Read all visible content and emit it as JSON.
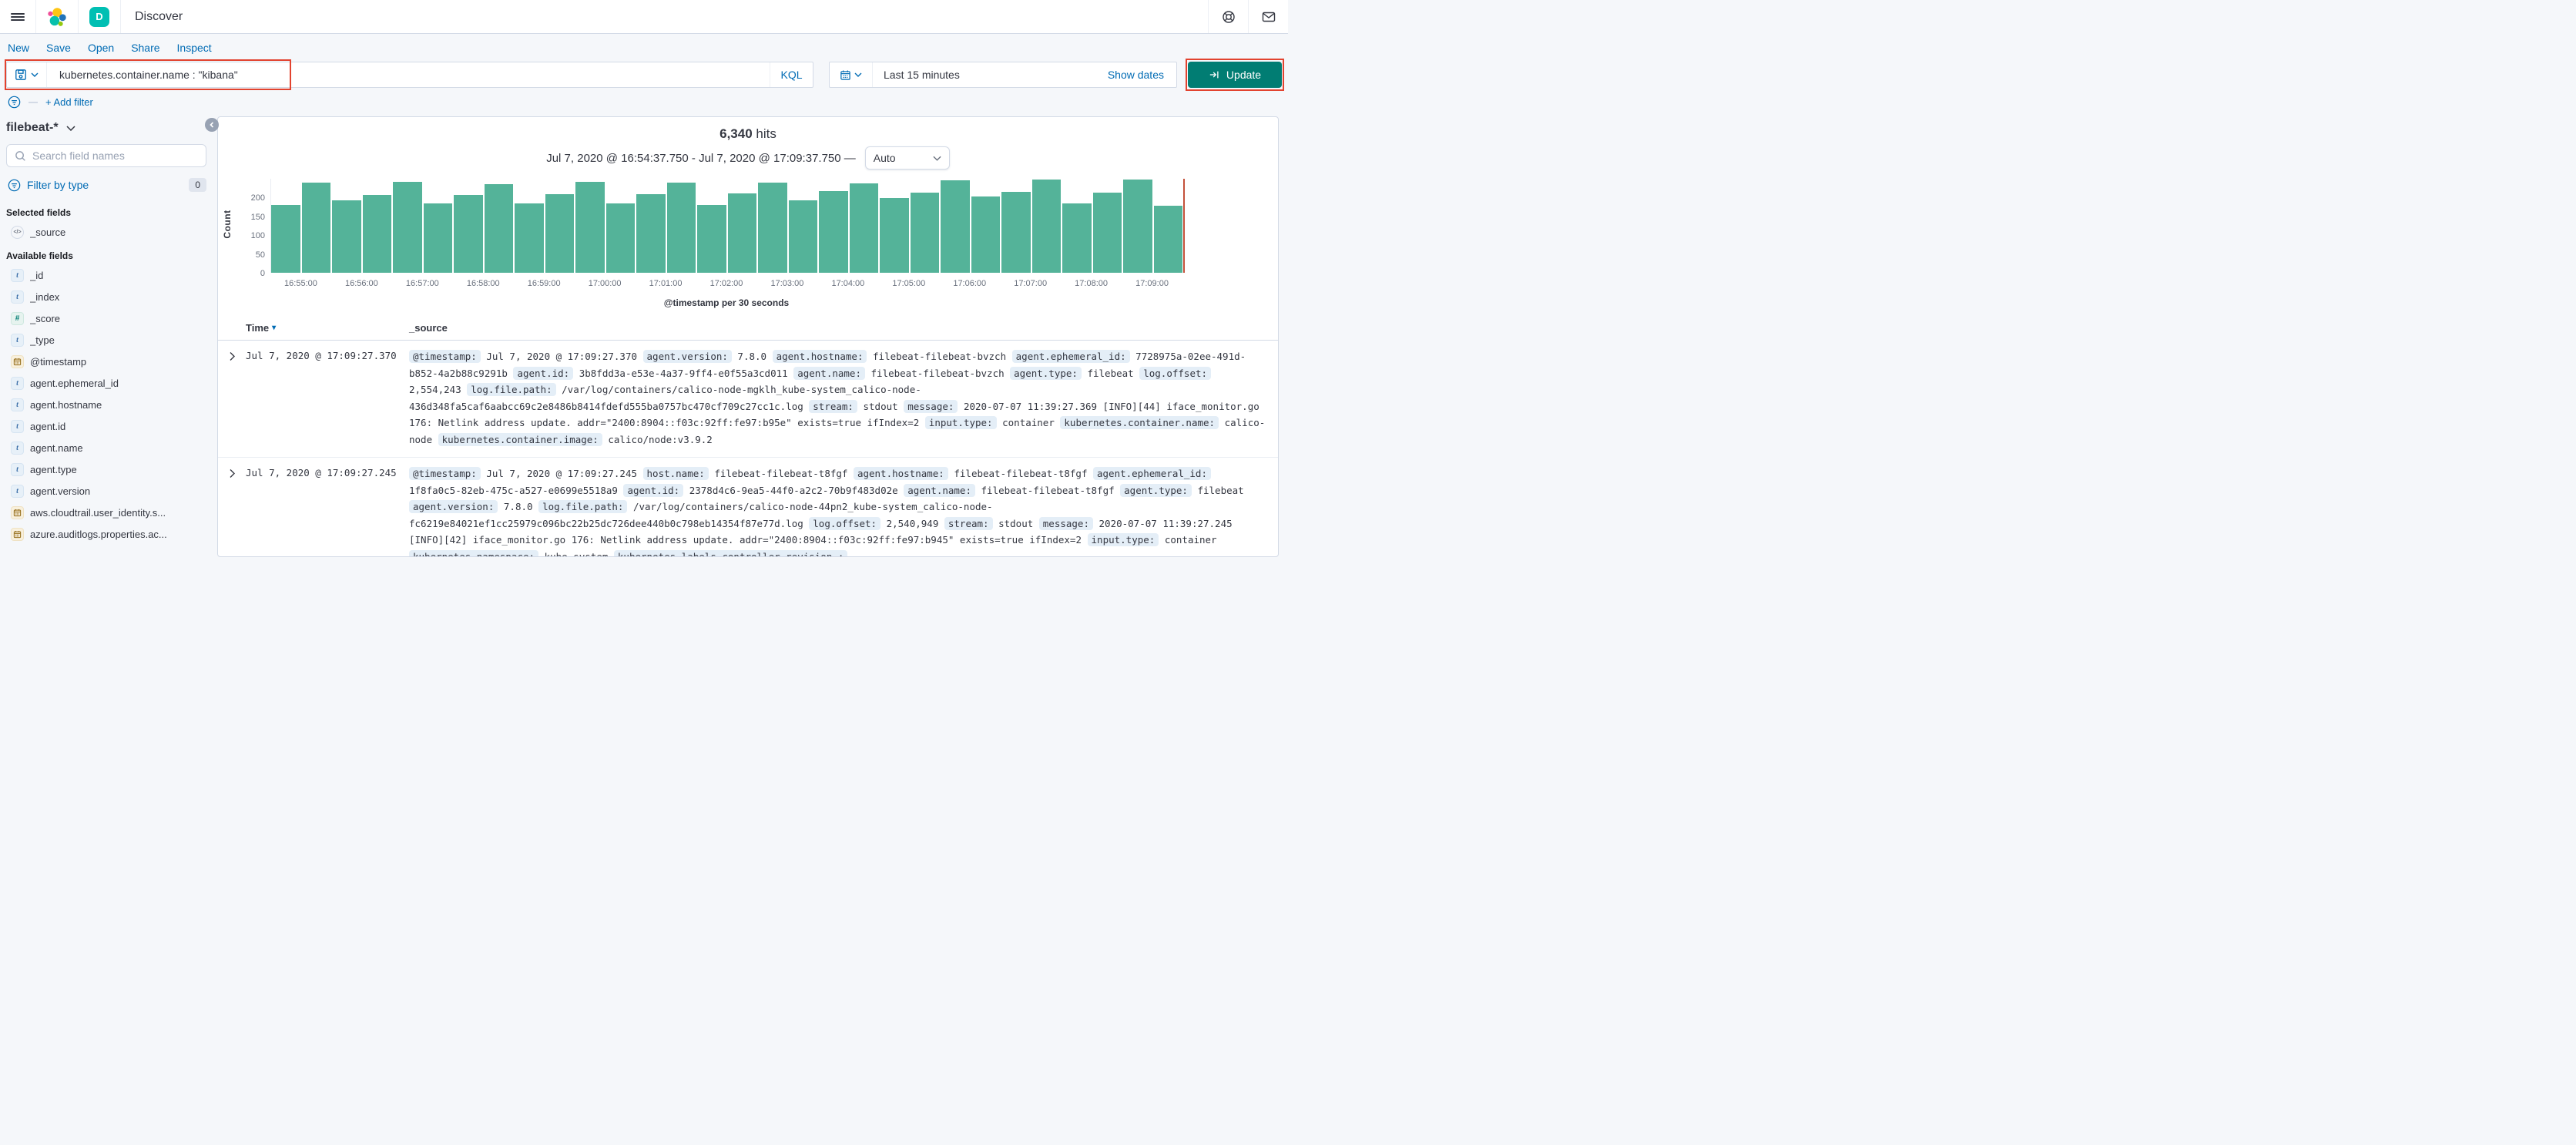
{
  "header": {
    "app_title": "Discover",
    "app_letter": "D"
  },
  "nav": {
    "items": [
      "New",
      "Save",
      "Open",
      "Share",
      "Inspect"
    ]
  },
  "query_bar": {
    "query": "kubernetes.container.name : \"kibana\"",
    "language_label": "KQL",
    "time_range": "Last 15 minutes",
    "show_dates_label": "Show dates",
    "update_label": "Update",
    "annotation_color": "#E2432F"
  },
  "filter_bar": {
    "add_filter_label": "+ Add filter"
  },
  "sidebar": {
    "index_pattern": "filebeat-*",
    "search_placeholder": "Search field names",
    "filter_by_type_label": "Filter by type",
    "filter_count": "0",
    "selected_fields_label": "Selected fields",
    "selected_fields": [
      {
        "name": "_source",
        "type": "source"
      }
    ],
    "available_fields_label": "Available fields",
    "available_fields": [
      {
        "name": "_id",
        "type": "t"
      },
      {
        "name": "_index",
        "type": "t"
      },
      {
        "name": "_score",
        "type": "#"
      },
      {
        "name": "_type",
        "type": "t"
      },
      {
        "name": "@timestamp",
        "type": "date"
      },
      {
        "name": "agent.ephemeral_id",
        "type": "t"
      },
      {
        "name": "agent.hostname",
        "type": "t"
      },
      {
        "name": "agent.id",
        "type": "t"
      },
      {
        "name": "agent.name",
        "type": "t"
      },
      {
        "name": "agent.type",
        "type": "t"
      },
      {
        "name": "agent.version",
        "type": "t"
      },
      {
        "name": "aws.cloudtrail.user_identity.s...",
        "type": "date"
      },
      {
        "name": "azure.auditlogs.properties.ac...",
        "type": "date"
      }
    ]
  },
  "hits": {
    "count": "6,340",
    "label": "hits",
    "range": "Jul 7, 2020 @ 16:54:37.750 - Jul 7, 2020 @ 17:09:37.750 —",
    "interval": "Auto"
  },
  "chart_data": {
    "type": "bar",
    "title": "6,340 hits",
    "ylabel": "Count",
    "xlabel": "@timestamp per 30 seconds",
    "ylim": [
      0,
      250
    ],
    "yticks": [
      0,
      50,
      100,
      150,
      200
    ],
    "bucket_seconds": 30,
    "xtick_labels": [
      "16:55:00",
      "16:56:00",
      "16:57:00",
      "16:58:00",
      "16:59:00",
      "17:00:00",
      "17:01:00",
      "17:02:00",
      "17:03:00",
      "17:04:00",
      "17:05:00",
      "17:06:00",
      "17:07:00",
      "17:08:00",
      "17:09:00"
    ],
    "values": [
      180,
      240,
      192,
      207,
      242,
      185,
      207,
      235,
      185,
      210,
      242,
      184,
      210,
      239,
      180,
      212,
      240,
      192,
      218,
      238,
      198,
      213,
      245,
      202,
      216,
      247,
      184,
      214,
      247,
      178
    ],
    "bar_color": "#54B399",
    "current_time_marker_color": "#C4513A",
    "legend": "off",
    "grid": "off"
  },
  "table": {
    "columns": [
      "Time",
      "_source"
    ],
    "rows": [
      {
        "time": "Jul 7, 2020 @ 17:09:27.370",
        "fields": [
          {
            "k": "@timestamp",
            "v": "Jul 7, 2020 @ 17:09:27.370"
          },
          {
            "k": "agent.version",
            "v": "7.8.0"
          },
          {
            "k": "agent.hostname",
            "v": "filebeat-filebeat-bvzch"
          },
          {
            "k": "agent.ephemeral_id",
            "v": "7728975a-02ee-491d-b852-4a2b88c9291b"
          },
          {
            "k": "agent.id",
            "v": "3b8fdd3a-e53e-4a37-9ff4-e0f55a3cd011"
          },
          {
            "k": "agent.name",
            "v": "filebeat-filebeat-bvzch"
          },
          {
            "k": "agent.type",
            "v": "filebeat"
          },
          {
            "k": "log.offset",
            "v": "2,554,243"
          },
          {
            "k": "log.file.path",
            "v": "/var/log/containers/calico-node-mgklh_kube-system_calico-node-436d348fa5caf6aabcc69c2e8486b8414fdefd555ba0757bc470cf709c27cc1c.log"
          },
          {
            "k": "stream",
            "v": "stdout"
          },
          {
            "k": "message",
            "v": "2020-07-07 11:39:27.369 [INFO][44] iface_monitor.go 176: Netlink address update. addr=\"2400:8904::f03c:92ff:fe97:b95e\" exists=true ifIndex=2"
          },
          {
            "k": "input.type",
            "v": "container"
          },
          {
            "k": "kubernetes.container.name",
            "v": "calico-node"
          },
          {
            "k": "kubernetes.container.image",
            "v": "calico/node:v3.9.2"
          }
        ]
      },
      {
        "time": "Jul 7, 2020 @ 17:09:27.245",
        "fields": [
          {
            "k": "@timestamp",
            "v": "Jul 7, 2020 @ 17:09:27.245"
          },
          {
            "k": "host.name",
            "v": "filebeat-filebeat-t8fgf"
          },
          {
            "k": "agent.hostname",
            "v": "filebeat-filebeat-t8fgf"
          },
          {
            "k": "agent.ephemeral_id",
            "v": "1f8fa0c5-82eb-475c-a527-e0699e5518a9"
          },
          {
            "k": "agent.id",
            "v": "2378d4c6-9ea5-44f0-a2c2-70b9f483d02e"
          },
          {
            "k": "agent.name",
            "v": "filebeat-filebeat-t8fgf"
          },
          {
            "k": "agent.type",
            "v": "filebeat"
          },
          {
            "k": "agent.version",
            "v": "7.8.0"
          },
          {
            "k": "log.file.path",
            "v": "/var/log/containers/calico-node-44pn2_kube-system_calico-node-fc6219e84021ef1cc25979c096bc22b25dc726dee440b0c798eb14354f87e77d.log"
          },
          {
            "k": "log.offset",
            "v": "2,540,949"
          },
          {
            "k": "stream",
            "v": "stdout"
          },
          {
            "k": "message",
            "v": "2020-07-07 11:39:27.245 [INFO][42] iface_monitor.go 176: Netlink address update. addr=\"2400:8904::f03c:92ff:fe97:b945\" exists=true ifIndex=2"
          },
          {
            "k": "input.type",
            "v": "container"
          },
          {
            "k": "kubernetes.namespace",
            "v": "kube-system"
          },
          {
            "k": "kubernetes.labels.controller-revision-",
            "v": ""
          }
        ]
      }
    ]
  },
  "icons": [
    "hamburger-icon",
    "elastic-logo",
    "kibana-app-icon",
    "help-icon",
    "mail-icon",
    "save-icon",
    "chevron-down-icon",
    "calendar-icon",
    "filter-icon",
    "search-icon",
    "collapse-icon",
    "sort-desc-icon",
    "expand-row-icon",
    "update-arrow-icon",
    "source-code-icon"
  ]
}
